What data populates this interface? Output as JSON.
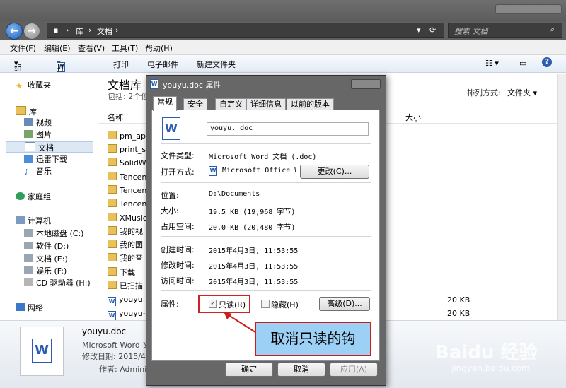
{
  "address": {
    "root": "库",
    "folder": "文档",
    "search_placeholder": "搜索 文档"
  },
  "menu": [
    "文件(F)",
    "编辑(E)",
    "查看(V)",
    "工具(T)",
    "帮助(H)"
  ],
  "toolbar": {
    "organize": "组织",
    "open": "打开",
    "print": "打印",
    "email": "电子邮件",
    "new_folder": "新建文件夹"
  },
  "sidebar": {
    "favorites": "收藏夹",
    "library": "库",
    "library_items": [
      "视频",
      "图片",
      "文档",
      "迅雷下载",
      "音乐"
    ],
    "homegroup": "家庭组",
    "computer": "计算机",
    "drives": [
      "本地磁盘 (C:)",
      "软件 (D:)",
      "文档 (E:)",
      "娱乐 (F:)",
      "CD 驱动器 (H:)"
    ],
    "network": "网络"
  },
  "library_header": {
    "title": "文档库",
    "subtitle": "包括: 2个位",
    "sort_label": "排列方式:",
    "sort_value": "文件夹"
  },
  "columns": {
    "name": "名称",
    "size": "大小"
  },
  "files": [
    "pm_ap",
    "print_s",
    "SolidW",
    "Tencen",
    "Tencen",
    "Tencen",
    "XMusic",
    "我的视",
    "我的图",
    "我的音",
    "下载",
    "已扫描",
    "youyu.",
    "youyu-"
  ],
  "file_sizes": [
    "20 KB",
    "20 KB"
  ],
  "details": {
    "name": "youyu.doc",
    "type": "Microsoft Word 文",
    "modified": "修改日期: 2015/4/",
    "author": "作者: Admini"
  },
  "dialog": {
    "title": "youyu.doc 属性",
    "tabs": [
      "常规",
      "安全",
      "自定义",
      "详细信息",
      "以前的版本"
    ],
    "filename": "youyu. doc",
    "file_type_label": "文件类型:",
    "file_type": "Microsoft Word 文档 (.doc)",
    "open_with_label": "打开方式:",
    "open_with": "Microsoft Office Wo",
    "change_button": "更改(C)...",
    "location_label": "位置:",
    "location": "D:\\Documents",
    "size_label": "大小:",
    "size": "19.5 KB (19,968 字节)",
    "disk_size_label": "占用空间:",
    "disk_size": "20.0 KB (20,480 字节)",
    "created_label": "创建时间:",
    "created": "2015年4月3日, 11:53:55",
    "modified_label": "修改时间:",
    "modified": "2015年4月3日, 11:53:55",
    "accessed_label": "访问时间:",
    "accessed": "2015年4月3日, 11:53:55",
    "attributes_label": "属性:",
    "readonly_label": "只读(R)",
    "readonly_checked": true,
    "hidden_label": "隐藏(H)",
    "hidden_checked": false,
    "advanced_button": "高级(D)...",
    "ok_button": "确定",
    "cancel_button": "取消",
    "apply_button": "应用(A)"
  },
  "callout_text": "取消只读的钩",
  "watermark": {
    "brand": "Baidu 经验",
    "url": "jingyan.baidu.com"
  }
}
